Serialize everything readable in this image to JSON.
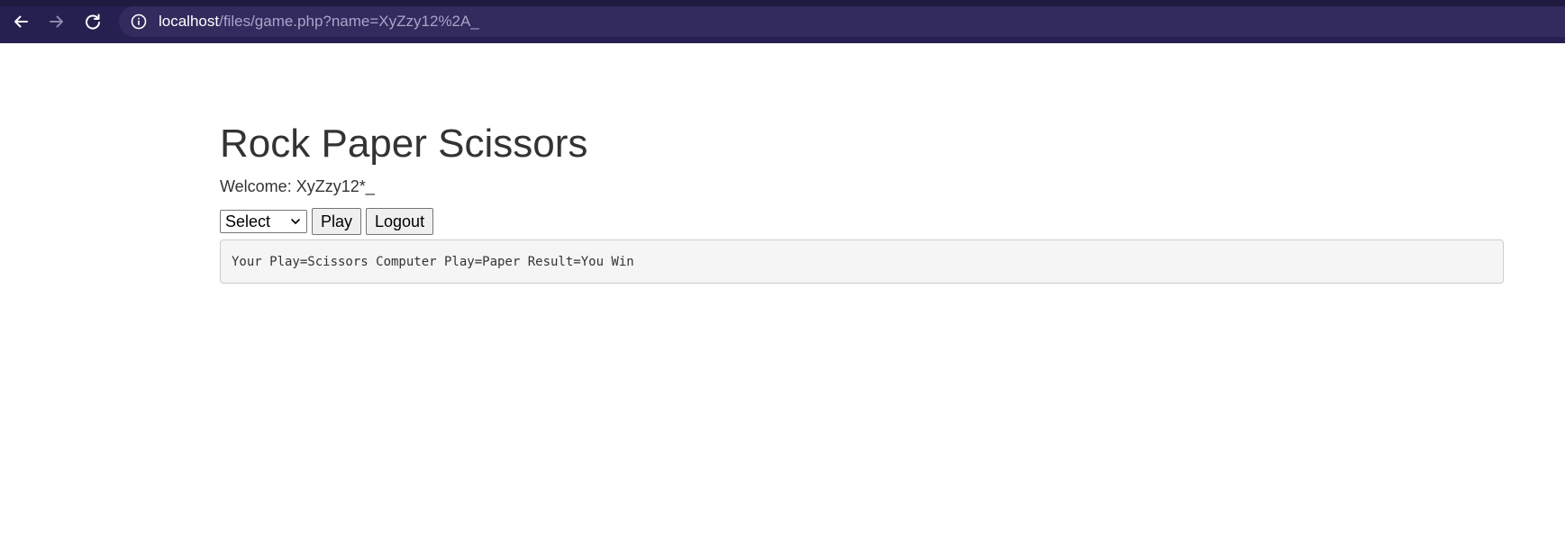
{
  "browser": {
    "url_host": "localhost",
    "url_path": "/files/game.php?name=XyZzy12%2A_",
    "icons": {
      "back": "arrow-left-icon",
      "forward": "arrow-right-icon",
      "reload": "reload-icon",
      "site_info": "info-icon"
    },
    "colors": {
      "chrome_bg": "#262050",
      "address_bg": "#332b5e"
    }
  },
  "page": {
    "title": "Rock Paper Scissors",
    "welcome": "Welcome: XyZzy12*_",
    "select": {
      "selected": "Select",
      "icon": "chevron-down-icon"
    },
    "buttons": {
      "play": "Play",
      "logout": "Logout"
    },
    "result": "Your Play=Scissors Computer Play=Paper Result=You Win"
  }
}
